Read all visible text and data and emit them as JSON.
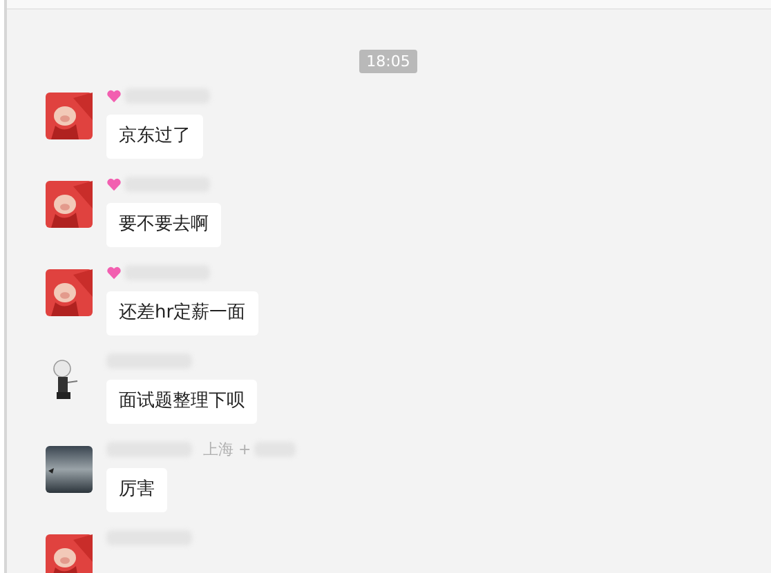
{
  "time_divider": "18:05",
  "messages": [
    {
      "kind": "pig",
      "heart": true,
      "text": "京东过了"
    },
    {
      "kind": "pig",
      "heart": true,
      "text": "要不要去啊"
    },
    {
      "kind": "pig",
      "heart": true,
      "text": "还差hr定薪一面"
    },
    {
      "kind": "figure",
      "heart": false,
      "text": "面试题整理下呗"
    },
    {
      "kind": "dark",
      "heart": false,
      "sender_text": "上海 +",
      "text": "厉害"
    },
    {
      "kind": "pig",
      "heart": false
    }
  ]
}
